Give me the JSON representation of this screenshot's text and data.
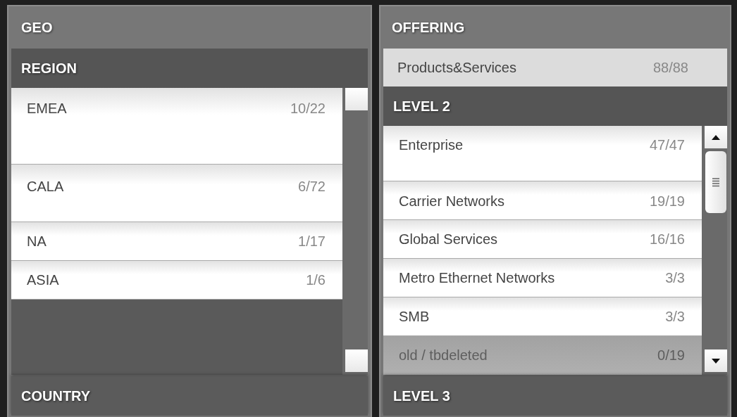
{
  "panels": [
    {
      "title": "GEO",
      "sections": [
        {
          "kind": "list",
          "title": "REGION",
          "arrows": false,
          "rows": [
            {
              "label": "EMEA",
              "count": "10/22",
              "disabled": false
            },
            {
              "label": "CALA",
              "count": "6/72",
              "disabled": false
            },
            {
              "label": "NA",
              "count": "1/17",
              "disabled": false
            },
            {
              "label": "ASIA",
              "count": "1/6",
              "disabled": false
            }
          ]
        },
        {
          "kind": "footer",
          "title": "COUNTRY"
        }
      ]
    },
    {
      "title": "OFFERING",
      "sections": [
        {
          "kind": "row",
          "label": "Products&Services",
          "count": "88/88"
        },
        {
          "kind": "list",
          "title": "LEVEL 2",
          "arrows": true,
          "rows": [
            {
              "label": "Enterprise",
              "count": "47/47",
              "disabled": false
            },
            {
              "label": "Carrier Networks",
              "count": "19/19",
              "disabled": false
            },
            {
              "label": "Global Services",
              "count": "16/16",
              "disabled": false
            },
            {
              "label": "Metro Ethernet Networks",
              "count": "3/3",
              "disabled": false
            },
            {
              "label": "SMB",
              "count": "3/3",
              "disabled": false
            },
            {
              "label": "old / tbdeleted",
              "count": "0/19",
              "disabled": true
            }
          ]
        },
        {
          "kind": "footer",
          "title": "LEVEL 3"
        }
      ]
    }
  ]
}
